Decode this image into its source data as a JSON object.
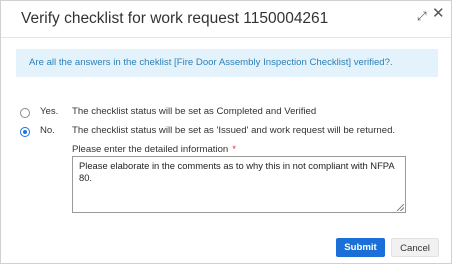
{
  "dialog": {
    "title": "Verify checklist for work request 1150004261",
    "expand_icon": "expand-icon",
    "close_icon": "close-icon"
  },
  "banner": {
    "text": "Are all the answers in the cheklist [Fire Door Assembly Inspection Checklist] verified?."
  },
  "options": [
    {
      "label": "Yes.",
      "description": "The checklist status will be set as Completed and Verified",
      "selected": false
    },
    {
      "label": "No.",
      "description": "The checklist status will be set as 'Issued' and work request will be returned.",
      "selected": true
    }
  ],
  "details": {
    "label": "Please enter the detailed information",
    "required_marker": "*",
    "value": "Please elaborate in the comments as to why this in not compliant with NFPA 80."
  },
  "buttons": {
    "submit": "Submit",
    "cancel": "Cancel"
  },
  "colors": {
    "accent": "#1a6fd8",
    "banner_bg": "#e4f3fb",
    "banner_text": "#2a80b8",
    "required": "#d9363e"
  }
}
